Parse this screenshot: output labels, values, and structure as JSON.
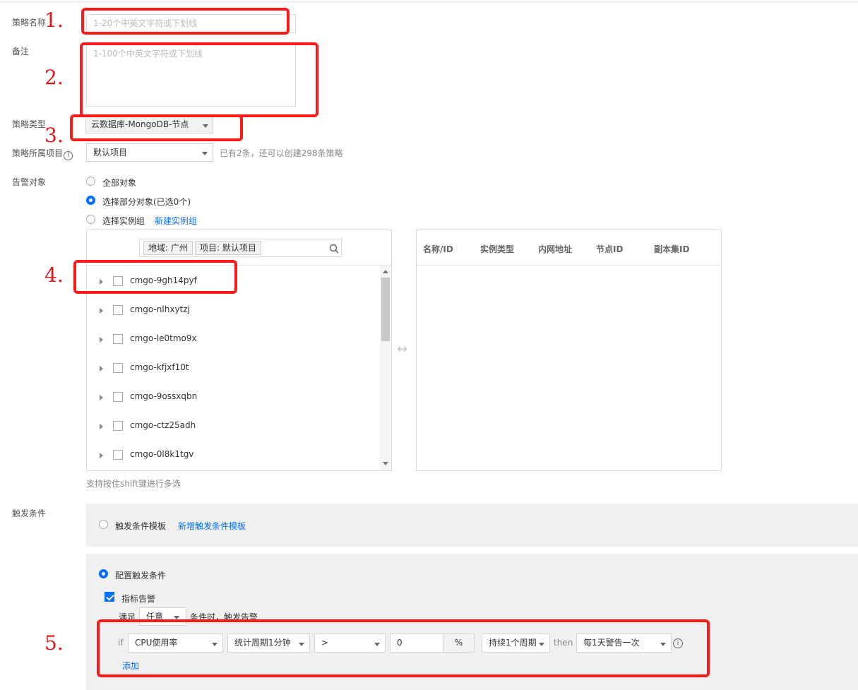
{
  "form": {
    "name_label": "策略名称",
    "name_placeholder": "1-20个中英文字符或下划线",
    "remark_label": "备注",
    "remark_placeholder": "1-100个中英文字符或下划线",
    "type_label": "策略类型",
    "type_value": "云数据库-MongoDB-节点",
    "project_label": "策略所属项目",
    "project_value": "默认项目",
    "project_hint": "已有2条，还可以创建298条策略",
    "target_label": "告警对象",
    "radio_all": "全部对象",
    "radio_partial": "选择部分对象(已选0个)",
    "radio_group": "选择实例组",
    "new_group_link": "新建实例组"
  },
  "picker": {
    "tag_region": "地域: 广州",
    "tag_project": "项目: 默认项目",
    "instances": [
      "cmgo-9gh14pyf",
      "cmgo-nlhxytzj",
      "cmgo-le0tmo9x",
      "cmgo-kfjxf10t",
      "cmgo-9ossxqbn",
      "cmgo-ctz25adh",
      "cmgo-0l8k1tgv"
    ],
    "multi_hint": "支持按住shift键进行多选",
    "swap_glyph": "↔",
    "columns": [
      "名称/ID",
      "实例类型",
      "内网地址",
      "节点ID",
      "副本集ID"
    ]
  },
  "trigger": {
    "label": "触发条件",
    "template_radio": "触发条件模板",
    "new_template_link": "新增触发条件模板",
    "config_radio": "配置触发条件",
    "metric_check": "指标告警",
    "satisfy_prefix": "满足",
    "satisfy_value": "任意",
    "satisfy_suffix": "条件时，触发告警",
    "if_label": "if",
    "metric": "CPU使用率",
    "period": "统计周期1分钟",
    "operator": ">",
    "threshold": "0",
    "unit": "%",
    "duration": "持续1个周期",
    "then_label": "then",
    "alarm_freq": "每1天警告一次",
    "add_link": "添加"
  },
  "annotations": [
    "1.",
    "2.",
    "3.",
    "4.",
    "5."
  ],
  "colors": {
    "accent": "#006eff",
    "annotation": "#ff1a1a"
  }
}
